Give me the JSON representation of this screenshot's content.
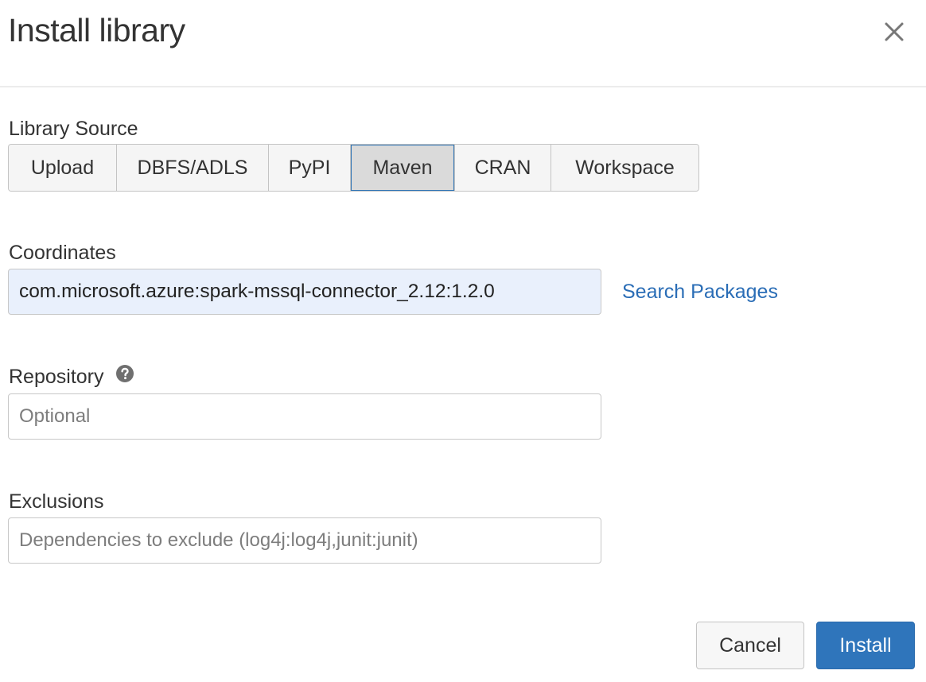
{
  "dialog": {
    "title": "Install library"
  },
  "library_source": {
    "label": "Library Source",
    "options": [
      "Upload",
      "DBFS/ADLS",
      "PyPI",
      "Maven",
      "CRAN",
      "Workspace"
    ],
    "selected": "Maven"
  },
  "coordinates": {
    "label": "Coordinates",
    "value": "com.microsoft.azure:spark-mssql-connector_2.12:1.2.0",
    "search_link": "Search Packages"
  },
  "repository": {
    "label": "Repository",
    "placeholder": "Optional",
    "value": ""
  },
  "exclusions": {
    "label": "Exclusions",
    "placeholder": "Dependencies to exclude (log4j:log4j,junit:junit)",
    "value": ""
  },
  "footer": {
    "cancel_label": "Cancel",
    "install_label": "Install"
  },
  "colors": {
    "primary": "#2f75bb",
    "link": "#2a6db6",
    "selected_border": "#2f74b5",
    "coords_bg": "#e9f0fc"
  },
  "icons": {
    "close": "close-icon",
    "help": "question-circle-icon"
  }
}
